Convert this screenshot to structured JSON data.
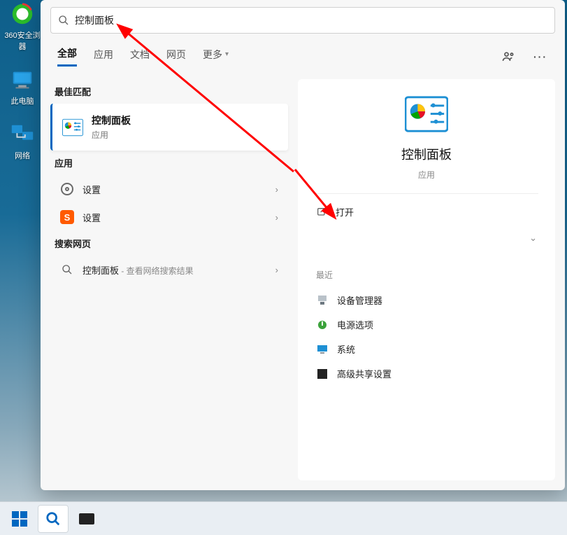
{
  "desktop": {
    "icons": [
      {
        "name": "360安全浏览器",
        "label_lines": [
          "360安全浏",
          "器"
        ]
      },
      {
        "name": "此电脑",
        "label": "此电脑"
      },
      {
        "name": "网络",
        "label": "网络"
      }
    ]
  },
  "search": {
    "query": "控制面板",
    "tabs": {
      "all": "全部",
      "apps": "应用",
      "docs": "文档",
      "web": "网页",
      "more": "更多"
    },
    "sections": {
      "best_match": "最佳匹配",
      "apps": "应用",
      "web": "搜索网页"
    },
    "best_match": {
      "title": "控制面板",
      "subtitle": "应用"
    },
    "app_rows": [
      {
        "label": "设置",
        "icon": "gear"
      },
      {
        "label": "设置",
        "icon": "sogou"
      }
    ],
    "web_row": {
      "term": "控制面板",
      "hint": " - 查看网络搜索结果"
    }
  },
  "preview": {
    "title": "控制面板",
    "subtitle": "应用",
    "open_label": "打开",
    "recent_label": "最近",
    "recent": [
      {
        "label": "设备管理器"
      },
      {
        "label": "电源选项"
      },
      {
        "label": "系统"
      },
      {
        "label": "高级共享设置"
      }
    ]
  }
}
